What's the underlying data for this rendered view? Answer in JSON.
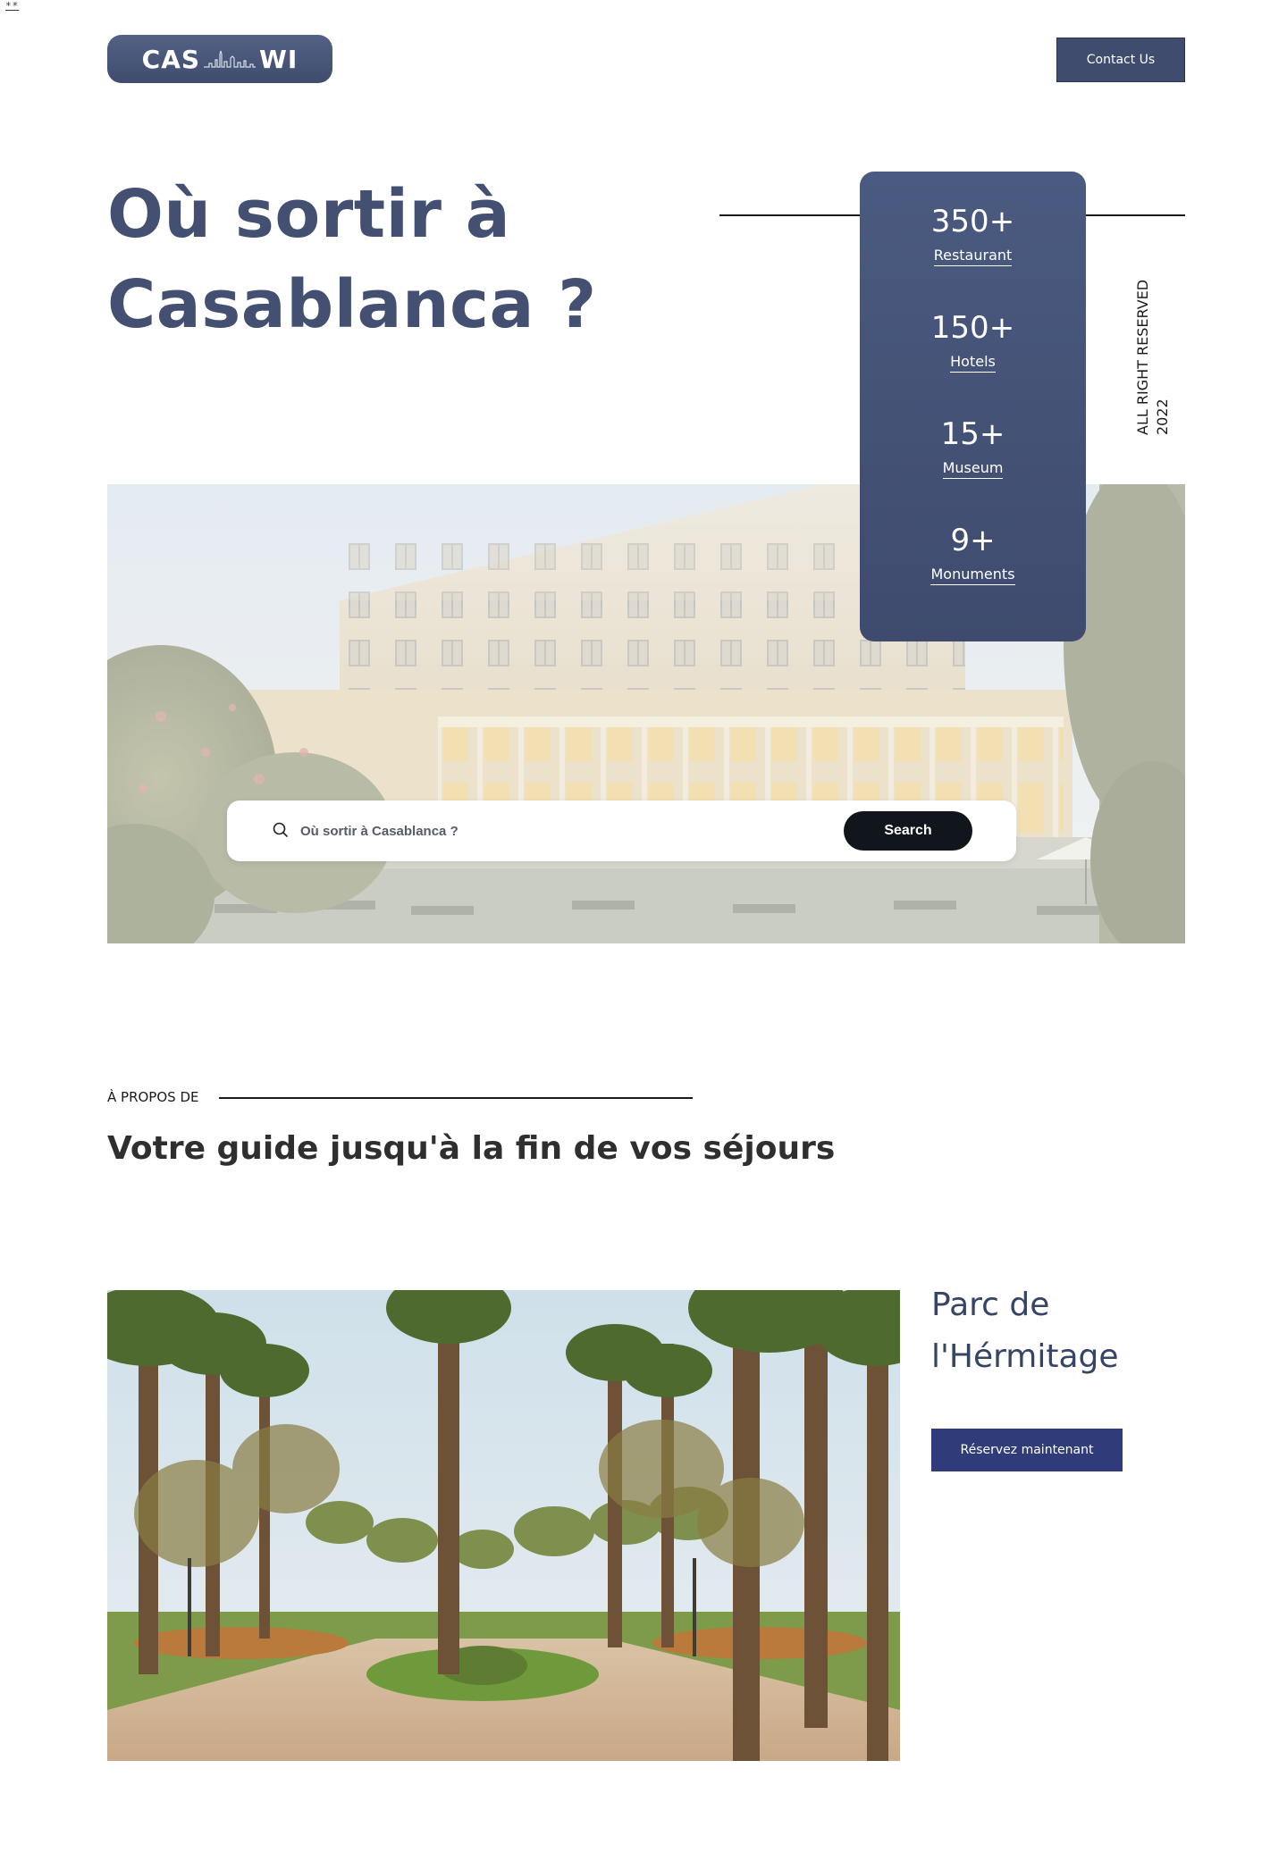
{
  "corner_mark": "**",
  "header": {
    "logo": {
      "left_text": "CAS",
      "right_text": "WI",
      "icon": "skyline-icon"
    },
    "contact_label": "Contact Us"
  },
  "hero": {
    "title_line1": "Où sortir à",
    "title_line2": "Casablanca ?",
    "vertical_year": "2022",
    "vertical_rights": "ALL RIGHT RESERVED",
    "image": "hotel-photo"
  },
  "stats": [
    {
      "value": "350+",
      "label": "Restaurant"
    },
    {
      "value": "150+",
      "label": "Hotels"
    },
    {
      "value": "15+",
      "label": "Museum"
    },
    {
      "value": "9+",
      "label": "Monuments"
    }
  ],
  "search": {
    "placeholder": "Où sortir à Casablanca ?",
    "button_label": "Search",
    "icon": "search-icon"
  },
  "about": {
    "eyebrow": "À PROPOS DE",
    "title": "Votre guide jusqu'à la fin de vos séjours"
  },
  "feature": {
    "title_line1": "Parc de",
    "title_line2": "l'Hérmitage",
    "button_label": "Réservez maintenant",
    "image": "park-photo"
  },
  "colors": {
    "brand": "#435071",
    "card": "#4a5a80",
    "button_dark": "#11151c",
    "reserve": "#2f3c79"
  }
}
